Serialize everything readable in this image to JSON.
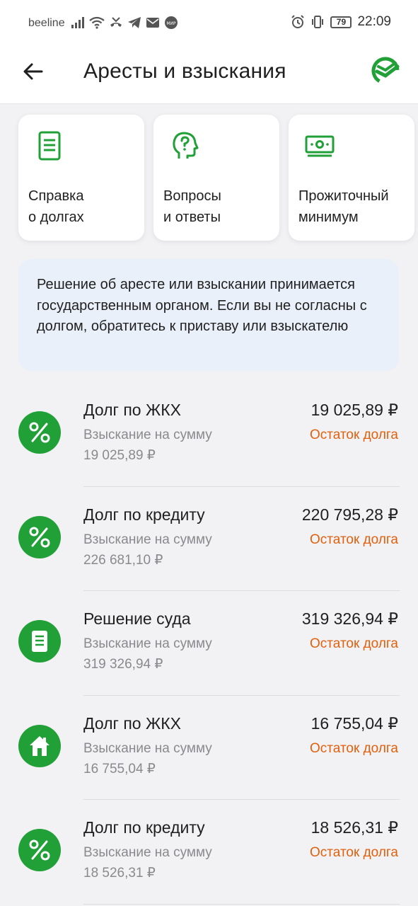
{
  "status_bar": {
    "carrier": "beeline",
    "battery": "79",
    "time": "22:09"
  },
  "header": {
    "title": "Аресты и взыскания",
    "logo_icon": "sber-logo-icon",
    "back_icon": "arrow-left-icon"
  },
  "cards": [
    {
      "label": "Справка\nо долгах",
      "icon": "document-icon"
    },
    {
      "label": "Вопросы\nи ответы",
      "icon": "question-head-icon"
    },
    {
      "label": "Прожиточный\nминимум",
      "icon": "banknote-icon"
    }
  ],
  "info": {
    "text": "Решение об аресте или взыскании принимается государственным органом. Если вы не согласны с долгом, обратитесь к приставу или взыскателю"
  },
  "debts": [
    {
      "title": "Долг по ЖКХ",
      "subtitle": "Взыскание на сумму",
      "sum": "19 025,89 ₽",
      "amount": "19 025,89 ₽",
      "status": "Остаток долга",
      "icon": "percent-icon"
    },
    {
      "title": "Долг по кредиту",
      "subtitle": "Взыскание на сумму",
      "sum": "226 681,10 ₽",
      "amount": "220 795,28 ₽",
      "status": "Остаток долга",
      "icon": "percent-icon"
    },
    {
      "title": "Решение суда",
      "subtitle": "Взыскание на сумму",
      "sum": "319 326,94 ₽",
      "amount": "319 326,94 ₽",
      "status": "Остаток долга",
      "icon": "document-icon"
    },
    {
      "title": "Долг по ЖКХ",
      "subtitle": "Взыскание на сумму",
      "sum": "16 755,04 ₽",
      "amount": "16 755,04 ₽",
      "status": "Остаток долга",
      "icon": "house-icon"
    },
    {
      "title": "Долг по кредиту",
      "subtitle": "Взыскание на сумму",
      "sum": "18 526,31 ₽",
      "amount": "18 526,31 ₽",
      "status": "Остаток долга",
      "icon": "percent-icon"
    }
  ],
  "colors": {
    "brand_green": "#21a038",
    "status_orange": "#e0600e",
    "info_bg": "#eaf0fa"
  }
}
